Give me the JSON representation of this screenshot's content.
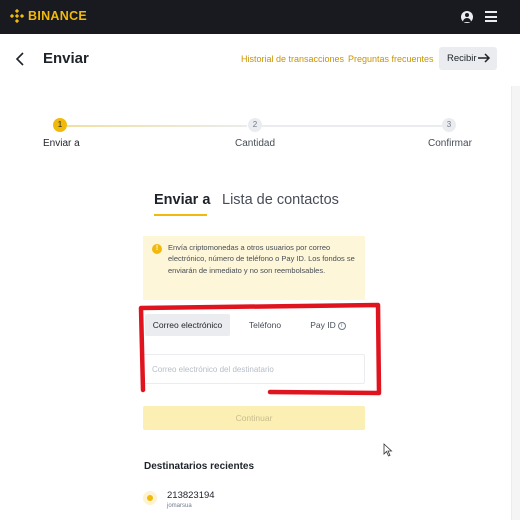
{
  "brand": {
    "name": "BINANCE",
    "color": "#f0b90b"
  },
  "topbar": {
    "user_icon": "user-circle-icon",
    "menu_icon": "hamburger-menu-icon"
  },
  "header": {
    "title": "Enviar",
    "links": [
      "Historial de transacciones",
      "Preguntas frecuentes"
    ],
    "recibir_label": "Recibir"
  },
  "stepper": {
    "steps": [
      {
        "number": "1",
        "label": "Enviar a",
        "active": true
      },
      {
        "number": "2",
        "label": "Cantidad",
        "active": false
      },
      {
        "number": "3",
        "label": "Confirmar",
        "active": false
      }
    ]
  },
  "tabs": {
    "active": "Enviar a",
    "inactive": "Lista de contactos"
  },
  "notice": {
    "icon": "exclamation-icon",
    "text": "Envía criptomonedas a otros usuarios por correo electrónico, número de teléfono o Pay ID. Los fondos se enviarán de inmediato y no son reembolsables."
  },
  "method_tabs": {
    "email": "Correo electrónico",
    "phone": "Teléfono",
    "payid": "Pay ID",
    "payid_icon": "info-icon"
  },
  "input": {
    "placeholder": "Correo electrónico del destinatario",
    "value": ""
  },
  "continue_label": "Continuar",
  "recent": {
    "title": "Destinatarios recientes",
    "items": [
      {
        "id": "213823194",
        "sub": "jomarsua"
      }
    ]
  },
  "colors": {
    "accent": "#f0b90b",
    "annotation_red": "#e0141e",
    "topbar_bg": "#181a20"
  }
}
